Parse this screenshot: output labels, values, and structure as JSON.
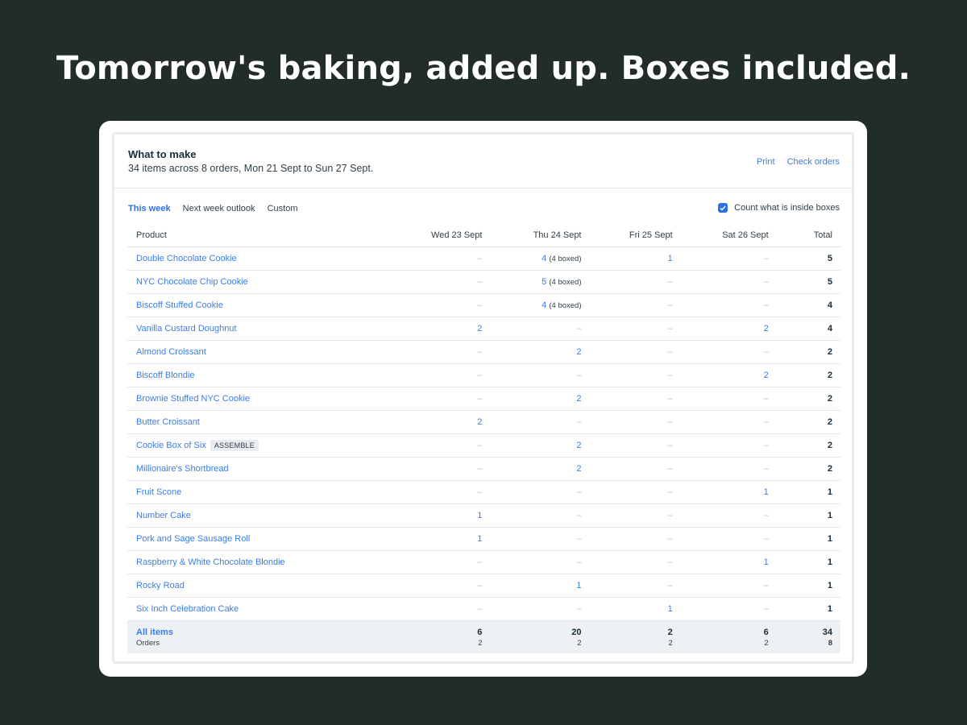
{
  "headline": "Tomorrow's baking, added up. Boxes included.",
  "panel": {
    "title": "What to make",
    "subtitle": "34 items across 8 orders, Mon 21 Sept to Sun 27 Sept.",
    "print_label": "Print",
    "check_orders_label": "Check orders"
  },
  "tabs": [
    "This week",
    "Next week outlook",
    "Custom"
  ],
  "checkbox": {
    "label": "Count what is inside boxes",
    "checked": true
  },
  "table": {
    "columns": [
      "Product",
      "Wed 23 Sept",
      "Thu 24 Sept",
      "Fri 25 Sept",
      "Sat 26 Sept",
      "Total"
    ],
    "empty_symbol": "–",
    "rows": [
      {
        "product": "Double Chocolate Cookie",
        "cells": [
          "–",
          "4",
          "1",
          "–"
        ],
        "boxed": [
          "",
          "(4 boxed)",
          "",
          ""
        ],
        "total": "5"
      },
      {
        "product": "NYC Chocolate Chip Cookie",
        "cells": [
          "–",
          "5",
          "–",
          "–"
        ],
        "boxed": [
          "",
          "(4 boxed)",
          "",
          ""
        ],
        "total": "5"
      },
      {
        "product": "Biscoff Stuffed Cookie",
        "cells": [
          "–",
          "4",
          "–",
          "–"
        ],
        "boxed": [
          "",
          "(4 boxed)",
          "",
          ""
        ],
        "total": "4"
      },
      {
        "product": "Vanilla Custard Doughnut",
        "cells": [
          "2",
          "–",
          "–",
          "2"
        ],
        "total": "4"
      },
      {
        "product": "Almond Croissant",
        "cells": [
          "–",
          "2",
          "–",
          "–"
        ],
        "total": "2"
      },
      {
        "product": "Biscoff Blondie",
        "cells": [
          "–",
          "–",
          "–",
          "2"
        ],
        "total": "2"
      },
      {
        "product": "Brownie Stuffed NYC Cookie",
        "cells": [
          "–",
          "2",
          "–",
          "–"
        ],
        "total": "2"
      },
      {
        "product": "Butter Croissant",
        "cells": [
          "2",
          "–",
          "–",
          "–"
        ],
        "total": "2"
      },
      {
        "product": "Cookie Box of Six",
        "badge": "ASSEMBLE",
        "cells": [
          "–",
          "2",
          "–",
          "–"
        ],
        "total": "2"
      },
      {
        "product": "Millionaire's Shortbread",
        "cells": [
          "–",
          "2",
          "–",
          "–"
        ],
        "total": "2"
      },
      {
        "product": "Fruit Scone",
        "cells": [
          "–",
          "–",
          "–",
          "1"
        ],
        "total": "1"
      },
      {
        "product": "Number Cake",
        "cells": [
          "1",
          "–",
          "–",
          "–"
        ],
        "total": "1"
      },
      {
        "product": "Pork and Sage Sausage Roll",
        "cells": [
          "1",
          "–",
          "–",
          "–"
        ],
        "total": "1"
      },
      {
        "product": "Raspberry & White Chocolate Blondie",
        "cells": [
          "–",
          "–",
          "–",
          "1"
        ],
        "total": "1"
      },
      {
        "product": "Rocky Road",
        "cells": [
          "–",
          "1",
          "–",
          "–"
        ],
        "total": "1"
      },
      {
        "product": "Six Inch Celebration Cake",
        "cells": [
          "–",
          "–",
          "1",
          "–"
        ],
        "total": "1"
      }
    ],
    "footer": {
      "label": "All items",
      "sublabel": "Orders",
      "items": [
        "6",
        "20",
        "2",
        "6",
        "34"
      ],
      "orders": [
        "2",
        "2",
        "2",
        "2",
        "8"
      ]
    }
  }
}
